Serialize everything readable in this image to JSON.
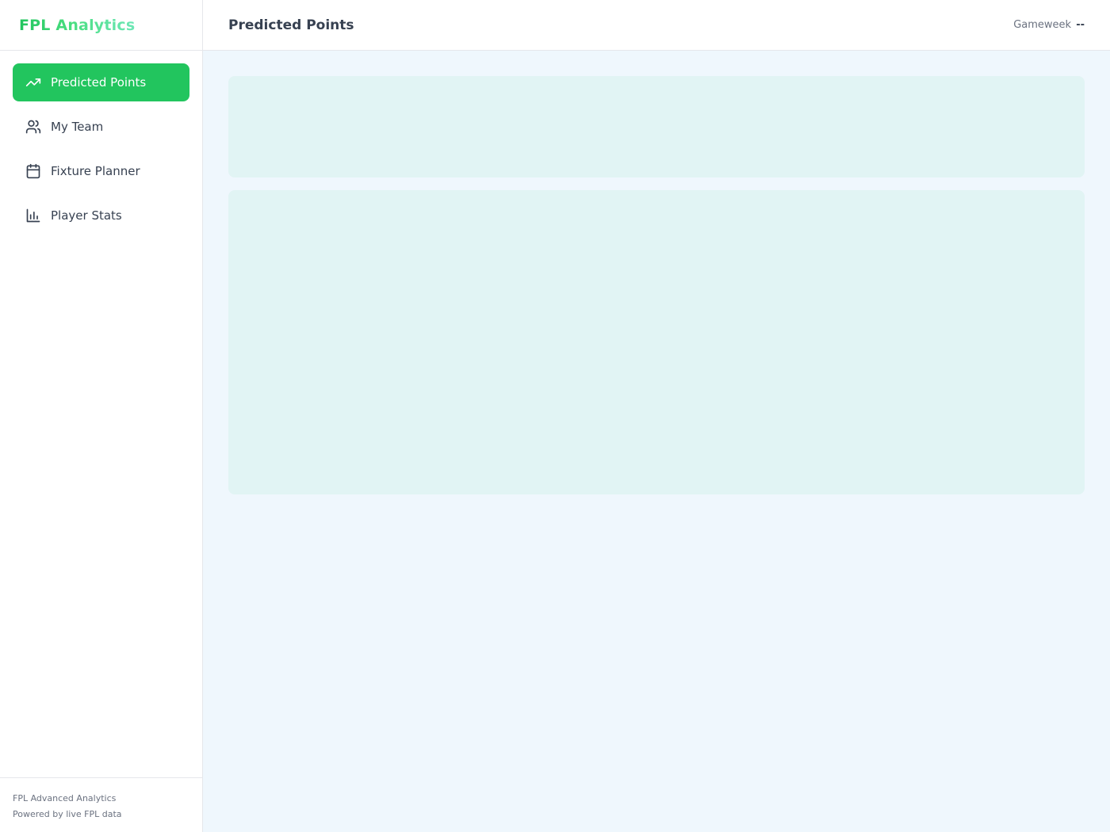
{
  "sidebar": {
    "brand": "FPL Analytics",
    "items": [
      {
        "label": "Predicted Points",
        "icon": "trending-up-icon",
        "active": true
      },
      {
        "label": "My Team",
        "icon": "users-icon",
        "active": false
      },
      {
        "label": "Fixture Planner",
        "icon": "calendar-icon",
        "active": false
      },
      {
        "label": "Player Stats",
        "icon": "bar-chart-icon",
        "active": false
      }
    ],
    "footer": {
      "line1": "FPL Advanced Analytics",
      "line2": "Powered by live FPL data"
    }
  },
  "header": {
    "title": "Predicted Points",
    "gameweek_label": "Gameweek",
    "gameweek_value": "--"
  },
  "colors": {
    "accent": "#22c55e",
    "content_bg": "#eff7fd",
    "skeleton": "#e1f4f4"
  }
}
